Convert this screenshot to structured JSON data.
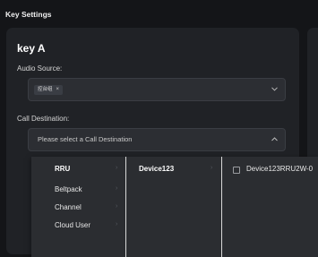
{
  "page_title": "Key Settings",
  "key": {
    "title": "key A",
    "audio_source": {
      "label": "Audio Source:",
      "tag": "控台组",
      "tag_close": "×"
    },
    "call_destination": {
      "label": "Call Destination:",
      "placeholder": "Please select a Call Destination"
    }
  },
  "dropdown": {
    "categories": [
      {
        "label": "RRU",
        "active": true
      },
      {
        "label": "Beltpack",
        "active": false
      },
      {
        "label": "Channel",
        "active": false
      },
      {
        "label": "Cloud User",
        "active": false
      }
    ],
    "devices": [
      {
        "label": "Device123",
        "active": true
      }
    ],
    "options": [
      {
        "label": "Device123RRU2W-0",
        "checked": false
      }
    ]
  },
  "icons": {
    "chevron": "chevron-down-icon",
    "submenu": "chevron-right-icon",
    "checkbox": "checkbox-icon"
  }
}
